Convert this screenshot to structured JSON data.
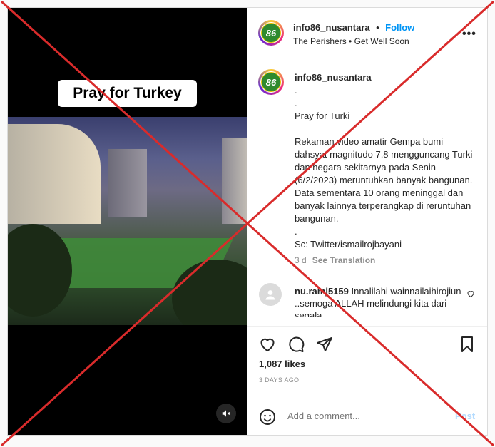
{
  "media": {
    "overlay_title": "Pray for Turkey",
    "mute_icon": "speaker-muted-icon"
  },
  "header": {
    "username": "info86_nusantara",
    "separator": "•",
    "follow_label": "Follow",
    "audio": "The Perishers • Get Well Soon",
    "more_icon": "more-options-icon",
    "avatar_text": "86"
  },
  "caption": {
    "username": "info86_nusantara",
    "text": ".\n.\nPray for Turki\n\nRekaman video amatir Gempa bumi dahsyat magnitudo 7,8 mengguncang Turki dan negara sekitarnya pada Senin (6/2/2023) meruntuhkan banyak bangunan. Data sementara 10 orang meninggal dan banyak lainnya terperangkap di reruntuhan bangunan.\n.\nSc: Twitter/ismailrojbayani",
    "time": "3 d",
    "see_translation": "See Translation"
  },
  "comment": {
    "username": "nu.ramj5159",
    "text": "Innalilahi wainnailaihirojiun ..semoga ALLAH melindungi kita dari segala"
  },
  "actions": {
    "like_icon": "heart-icon",
    "comment_icon": "comment-icon",
    "share_icon": "share-icon",
    "save_icon": "bookmark-icon"
  },
  "likes": "1,087 likes",
  "date": "3 DAYS AGO",
  "add_comment": {
    "placeholder": "Add a comment...",
    "post_label": "Post",
    "emoji_icon": "emoji-icon"
  },
  "colors": {
    "follow": "#0095f6",
    "overlay_x": "#d92b2b"
  }
}
